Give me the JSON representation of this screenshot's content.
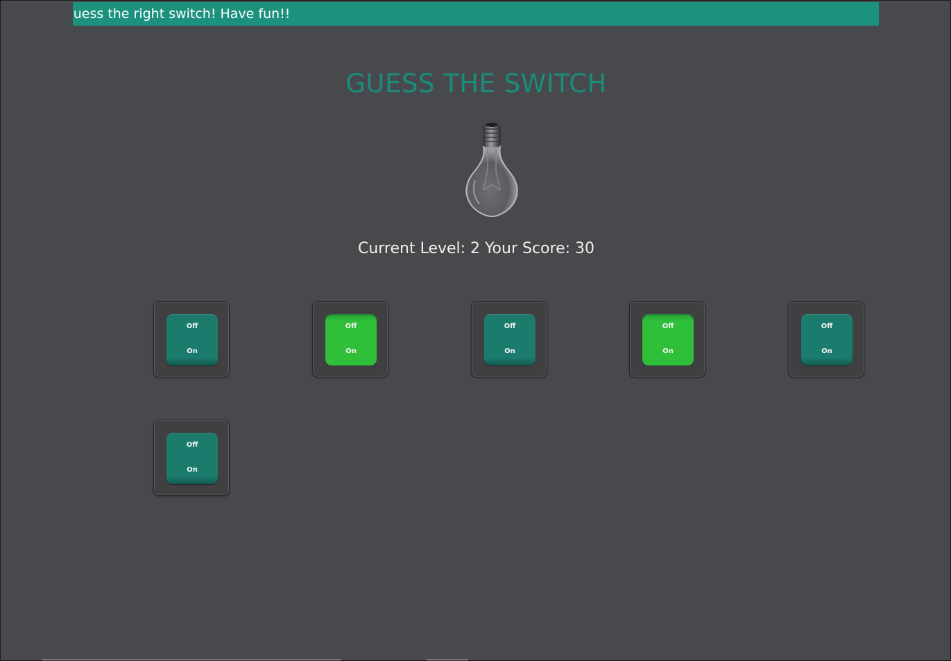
{
  "banner": {
    "text": "Guess the right switch! Have fun!!"
  },
  "game": {
    "title": "GUESS THE SWITCH",
    "bulb_lit": false,
    "status_text": "Current Level: 2 Your Score: 30",
    "current_level": 2,
    "score": 30
  },
  "switches": [
    {
      "off_label": "Off",
      "on_label": "On",
      "state": "off"
    },
    {
      "off_label": "Off",
      "on_label": "On",
      "state": "on"
    },
    {
      "off_label": "Off",
      "on_label": "On",
      "state": "off"
    },
    {
      "off_label": "Off",
      "on_label": "On",
      "state": "on"
    },
    {
      "off_label": "Off",
      "on_label": "On",
      "state": "off"
    },
    {
      "off_label": "Off",
      "on_label": "On",
      "state": "off"
    }
  ],
  "colors": {
    "background": "#48494d",
    "accent": "#1b917e",
    "switch_off": "#1b7c6d",
    "switch_on": "#2fbf38"
  },
  "icons": {
    "bulb": "light-bulb-icon"
  }
}
